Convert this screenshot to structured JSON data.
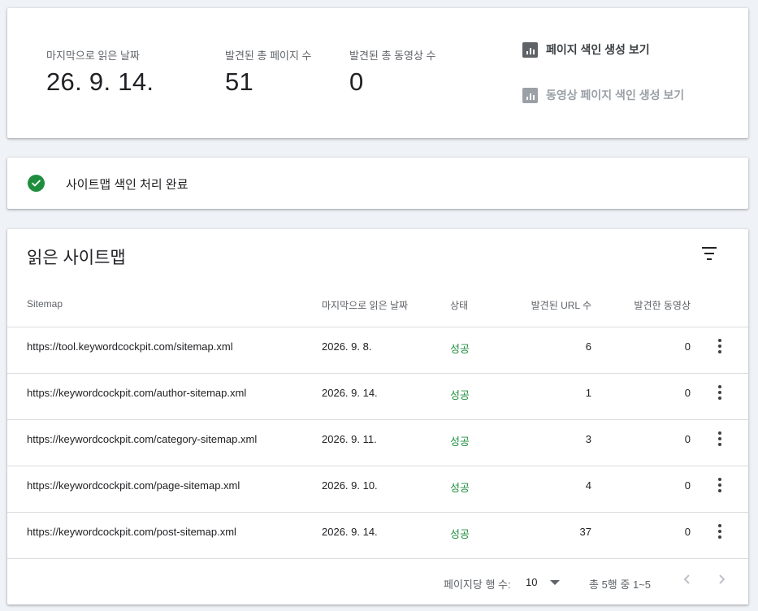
{
  "stats": {
    "last_read_label": "마지막으로 읽은 날짜",
    "last_read_value": "26. 9. 14.",
    "pages_label": "발견된 총 페이지 수",
    "pages_value": "51",
    "videos_label": "발견된 총 동영상 수",
    "videos_value": "0",
    "link_pages": "페이지 색인 생성 보기",
    "link_videos": "동영상 페이지 색인 생성 보기"
  },
  "status": {
    "text": "사이트맵 색인 처리 완료",
    "icon": "check-circle-icon",
    "color": "#1e8e3e"
  },
  "table": {
    "title": "읽은 사이트맵",
    "headers": {
      "sitemap": "Sitemap",
      "last_read": "마지막으로 읽은 날짜",
      "status": "상태",
      "url_count": "발견된 URL 수",
      "video_count": "발견한 동영상"
    },
    "rows": [
      {
        "url": "https://tool.keywordcockpit.com/sitemap.xml",
        "date": "2026. 9. 8.",
        "status": "성공",
        "urls": "6",
        "videos": "0"
      },
      {
        "url": "https://keywordcockpit.com/author-sitemap.xml",
        "date": "2026. 9. 14.",
        "status": "성공",
        "urls": "1",
        "videos": "0"
      },
      {
        "url": "https://keywordcockpit.com/category-sitemap.xml",
        "date": "2026. 9. 11.",
        "status": "성공",
        "urls": "3",
        "videos": "0"
      },
      {
        "url": "https://keywordcockpit.com/page-sitemap.xml",
        "date": "2026. 9. 10.",
        "status": "성공",
        "urls": "4",
        "videos": "0"
      },
      {
        "url": "https://keywordcockpit.com/post-sitemap.xml",
        "date": "2026. 9. 14.",
        "status": "성공",
        "urls": "37",
        "videos": "0"
      }
    ]
  },
  "pagination": {
    "rows_per_page_label": "페이지당 행 수:",
    "rows_per_page_value": "10",
    "range": "총 5행 중 1~5"
  },
  "colors": {
    "success": "#1e8e3e",
    "background": "#eff2f6"
  }
}
